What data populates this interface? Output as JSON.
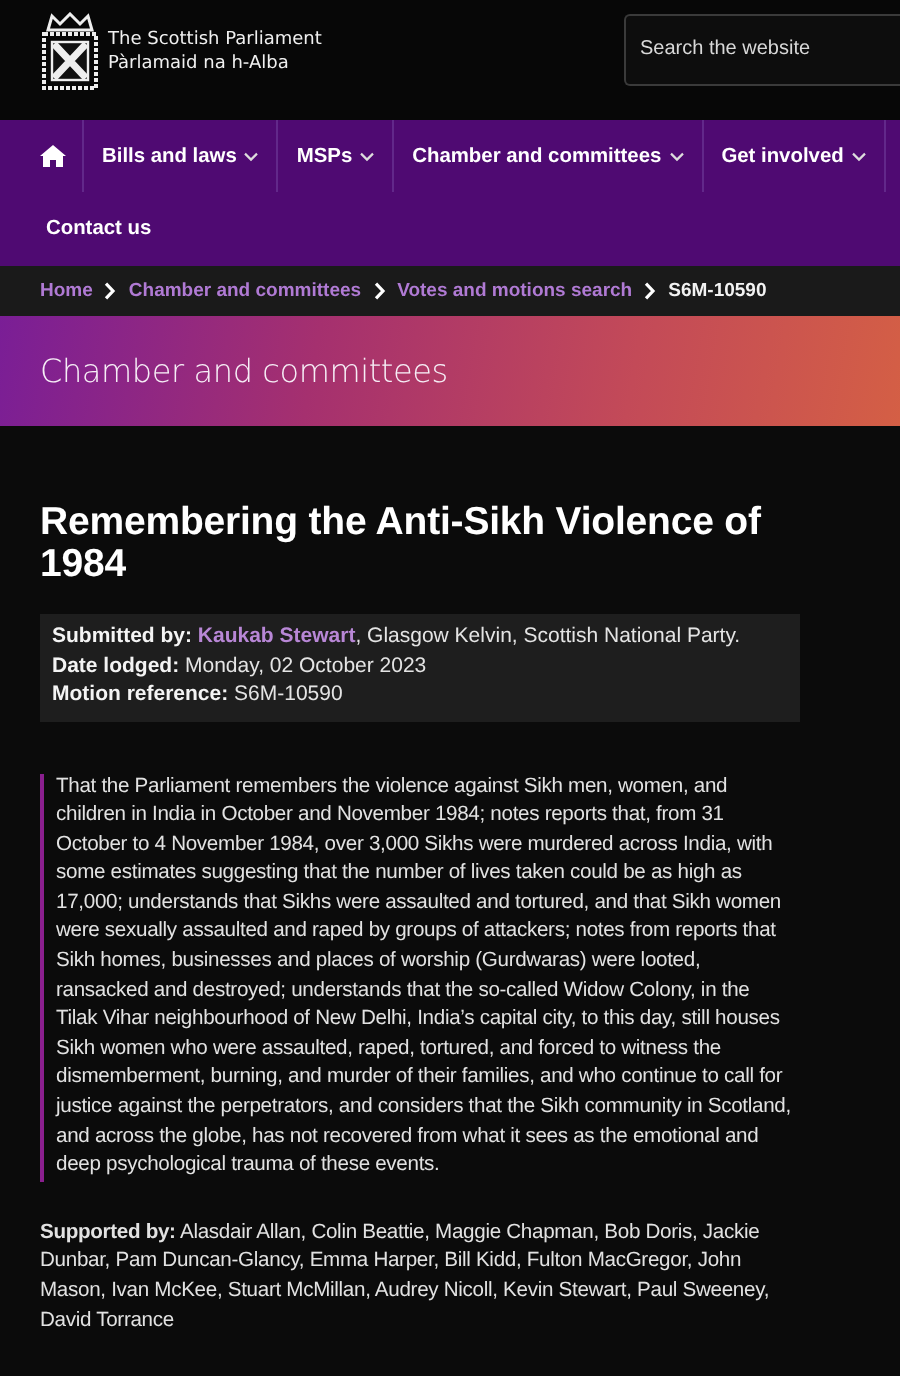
{
  "header": {
    "logo_lines": [
      "The Scottish Parliament",
      "Pàrlamaid na h-Alba"
    ],
    "search": {
      "placeholder": "Search the website"
    }
  },
  "nav": [
    {
      "kind": "home"
    },
    {
      "kind": "link",
      "label": "Bills and laws",
      "dropdown": true
    },
    {
      "kind": "link",
      "label": "MSPs",
      "dropdown": true
    },
    {
      "kind": "link",
      "label": "Chamber and committees",
      "dropdown": true
    },
    {
      "kind": "link",
      "label": "Get involved",
      "dropdown": true
    },
    {
      "kind": "link",
      "label": "Contact us",
      "dropdown": false
    }
  ],
  "breadcrumb": [
    {
      "label": "Home",
      "current": false
    },
    {
      "label": "Chamber and committees",
      "current": false
    },
    {
      "label": "Votes and motions search",
      "current": false
    },
    {
      "label": "S6M-10590",
      "current": true
    }
  ],
  "banner": {
    "title": "Chamber and committees"
  },
  "title": "Remembering the Anti-Sikh Violence of 1984",
  "meta": [
    {
      "text": "**Submitted by:** ",
      "link": "Kaukab Stewart",
      "after": ", Glasgow Kelvin, Scottish National Party."
    },
    {
      "text": "**Date lodged:** Monday, 02 October 2023"
    },
    {
      "text": "**Motion reference:** S6M-10590"
    }
  ],
  "motion_text": "That the Parliament remembers the violence against Sikh men, women, and children in India in October and November 1984; notes reports that, from 31 October to 4 November 1984, over 3,000 Sikhs were murdered across India, with some estimates suggesting that the number of lives taken could be as high as 17,000; understands that Sikhs were assaulted and tortured, and that Sikh women were sexually assaulted and raped by groups of attackers; notes from reports that Sikh homes, businesses and places of worship (Gurdwaras) were looted, ransacked and destroyed; understands that the so-called Widow Colony, in the Tilak Vihar neighbourhood of New Delhi, India’s capital city, to this day, still houses Sikh women who were assaulted, raped, tortured, and forced to witness the dismemberment, burning, and murder of their families, and who continue to call for justice against the perpetrators, and considers that the Sikh community in Scotland, and across the globe, has not recovered from what it sees as the emotional and deep psychological trauma of these events.",
  "supported_by": "**Supported by:** Alasdair Allan, Colin Beattie, Maggie Chapman, Bob Doris, Jackie Dunbar, Pam Duncan-Glancy, Emma Harper, Bill Kidd, Fulton MacGregor, John Mason, Ivan McKee, Stuart McMillan, Audrey Nicoll, Kevin Stewart, Paul Sweeney, David Torrance"
}
